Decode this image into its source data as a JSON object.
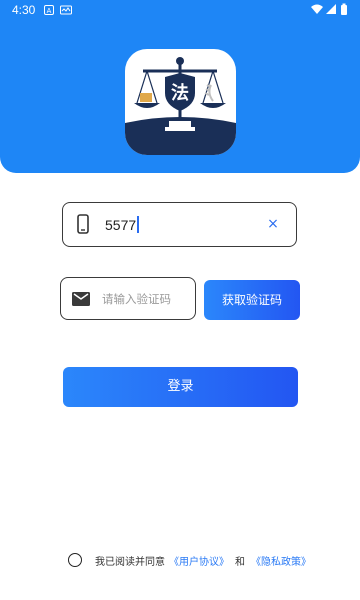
{
  "statusbar": {
    "time": "4:30"
  },
  "logo": {
    "character": "法"
  },
  "phone": {
    "value": "5577",
    "clear_glyph": "×"
  },
  "code": {
    "placeholder": "请输入验证码",
    "get_code_label": "获取验证码"
  },
  "login": {
    "label": "登录"
  },
  "agreement": {
    "prefix": "我已阅读并同意",
    "user_agreement": "《用户协议》",
    "and": "和",
    "privacy_policy": "《隐私政策》"
  },
  "colors": {
    "header": "#1e86f6",
    "accent": "#2a6cf0",
    "button_gradient_start": "#2b87fb",
    "button_gradient_end": "#2356f2",
    "logo_dark": "#1a2f57"
  }
}
